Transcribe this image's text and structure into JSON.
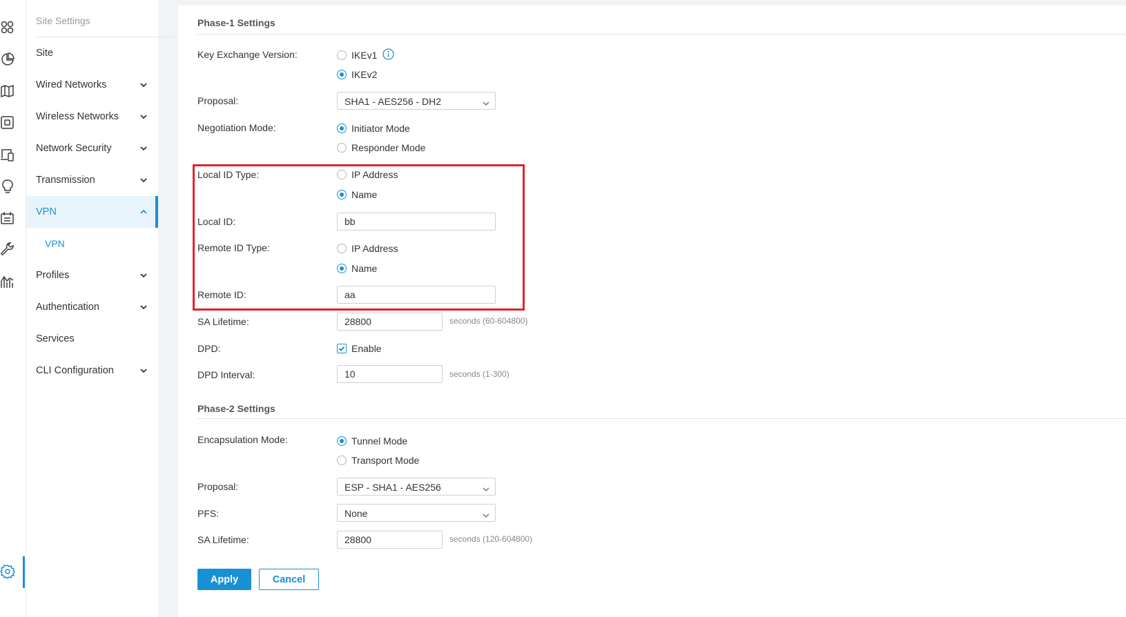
{
  "rail": {
    "icons": [
      "dashboard-icon",
      "statistics-icon",
      "map-icon",
      "devices-icon",
      "clients-icon",
      "insights-icon",
      "logs-icon",
      "tools-icon",
      "reports-icon",
      "settings-icon"
    ]
  },
  "sidebar": {
    "header": "Site Settings",
    "items": [
      {
        "label": "Site"
      },
      {
        "label": "Wired Networks"
      },
      {
        "label": "Wireless Networks"
      },
      {
        "label": "Network Security"
      },
      {
        "label": "Transmission"
      },
      {
        "label": "VPN"
      },
      {
        "label": "VPN"
      },
      {
        "label": "Profiles"
      },
      {
        "label": "Authentication"
      },
      {
        "label": "Services"
      },
      {
        "label": "CLI Configuration"
      }
    ],
    "active_item": "VPN"
  },
  "phase1": {
    "title": "Phase-1 Settings",
    "key_exchange": {
      "label": "Key Exchange Version:",
      "options": [
        "IKEv1",
        "IKEv2"
      ],
      "selected": "IKEv2"
    },
    "proposal": {
      "label": "Proposal:",
      "value": "SHA1 - AES256 - DH2"
    },
    "negotiation": {
      "label": "Negotiation Mode:",
      "options": [
        "Initiator Mode",
        "Responder Mode"
      ],
      "selected": "Initiator Mode"
    },
    "local_id_type": {
      "label": "Local ID Type:",
      "options": [
        "IP Address",
        "Name"
      ],
      "selected": "Name"
    },
    "local_id": {
      "label": "Local ID:",
      "value": "bb"
    },
    "remote_id_type": {
      "label": "Remote ID Type:",
      "options": [
        "IP Address",
        "Name"
      ],
      "selected": "Name"
    },
    "remote_id": {
      "label": "Remote ID:",
      "value": "aa"
    },
    "sa_lifetime": {
      "label": "SA Lifetime:",
      "value": "28800",
      "hint": "seconds (60-604800)"
    },
    "dpd": {
      "label": "DPD:",
      "checkbox_label": "Enable",
      "checked": true
    },
    "dpd_interval": {
      "label": "DPD Interval:",
      "value": "10",
      "hint": "seconds (1-300)"
    }
  },
  "phase2": {
    "title": "Phase-2 Settings",
    "encapsulation": {
      "label": "Encapsulation Mode:",
      "options": [
        "Tunnel Mode",
        "Transport Mode"
      ],
      "selected": "Tunnel Mode"
    },
    "proposal": {
      "label": "Proposal:",
      "value": "ESP - SHA1 - AES256"
    },
    "pfs": {
      "label": "PFS:",
      "value": "None"
    },
    "sa_lifetime": {
      "label": "SA Lifetime:",
      "value": "28800",
      "hint": "seconds (120-604800)"
    }
  },
  "buttons": {
    "apply": "Apply",
    "cancel": "Cancel"
  },
  "colors": {
    "accent": "#1890d5",
    "highlight": "#e2222c"
  }
}
